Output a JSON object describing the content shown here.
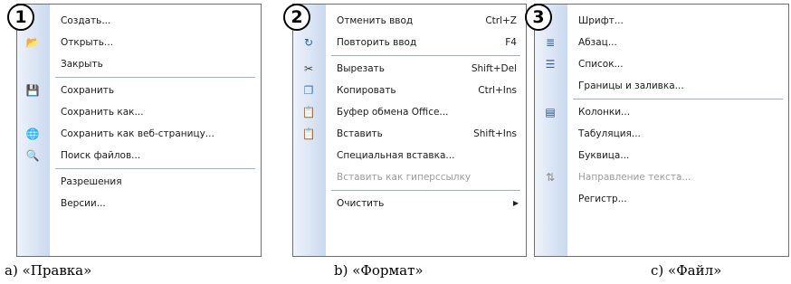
{
  "menus": [
    {
      "badge": "1",
      "caption": "а) «Правка»",
      "items": [
        {
          "type": "item",
          "label": "Создать...",
          "icon": ""
        },
        {
          "type": "item",
          "label": "Открыть...",
          "icon": "open-folder-icon"
        },
        {
          "type": "item",
          "label": "Закрыть",
          "icon": ""
        },
        {
          "type": "sep"
        },
        {
          "type": "item",
          "label": "Сохранить",
          "icon": "save-icon"
        },
        {
          "type": "item",
          "label": "Сохранить как...",
          "icon": ""
        },
        {
          "type": "item",
          "label": "Сохранить как веб-страницу...",
          "icon": "web-page-icon"
        },
        {
          "type": "item",
          "label": "Поиск файлов...",
          "icon": "file-search-icon"
        },
        {
          "type": "sep"
        },
        {
          "type": "item",
          "label": "Разрешения",
          "icon": ""
        },
        {
          "type": "item",
          "label": "Версии...",
          "icon": ""
        }
      ]
    },
    {
      "badge": "2",
      "caption": "b) «Формат»",
      "items": [
        {
          "type": "item",
          "label": "Отменить ввод",
          "shortcut": "Ctrl+Z",
          "icon": ""
        },
        {
          "type": "item",
          "label": "Повторить ввод",
          "shortcut": "F4",
          "icon": "redo-icon"
        },
        {
          "type": "sep"
        },
        {
          "type": "item",
          "label": "Вырезать",
          "shortcut": "Shift+Del",
          "icon": "scissors-icon"
        },
        {
          "type": "item",
          "label": "Копировать",
          "shortcut": "Ctrl+Ins",
          "icon": "copy-icon"
        },
        {
          "type": "item",
          "label": "Буфер обмена Office...",
          "icon": "clipboard-icon"
        },
        {
          "type": "item",
          "label": "Вставить",
          "shortcut": "Shift+Ins",
          "icon": "paste-icon"
        },
        {
          "type": "item",
          "label": "Специальная вставка...",
          "icon": ""
        },
        {
          "type": "item",
          "label": "Вставить как гиперссылку",
          "icon": "",
          "disabled": true
        },
        {
          "type": "sep"
        },
        {
          "type": "item",
          "label": "Очистить",
          "icon": "",
          "submenu": true
        }
      ]
    },
    {
      "badge": "3",
      "caption": "c) «Файл»",
      "items": [
        {
          "type": "item",
          "label": "Шрифт...",
          "icon": ""
        },
        {
          "type": "item",
          "label": "Абзац...",
          "icon": "paragraph-icon"
        },
        {
          "type": "item",
          "label": "Список...",
          "icon": "list-icon"
        },
        {
          "type": "item",
          "label": "Границы и заливка...",
          "icon": ""
        },
        {
          "type": "sep"
        },
        {
          "type": "item",
          "label": "Колонки...",
          "icon": "columns-icon"
        },
        {
          "type": "item",
          "label": "Табуляция...",
          "icon": ""
        },
        {
          "type": "item",
          "label": "Буквица...",
          "icon": ""
        },
        {
          "type": "item",
          "label": "Направление текста...",
          "icon": "text-direction-icon",
          "disabled": true
        },
        {
          "type": "item",
          "label": "Регистр...",
          "icon": ""
        }
      ]
    }
  ],
  "icon_glyphs": {
    "open-folder-icon": "📂",
    "save-icon": "💾",
    "web-page-icon": "🌐",
    "file-search-icon": "🔍",
    "redo-icon": "↻",
    "scissors-icon": "✂",
    "copy-icon": "❐",
    "clipboard-icon": "📋",
    "paste-icon": "📋",
    "paragraph-icon": "≣",
    "list-icon": "☰",
    "columns-icon": "▤",
    "text-direction-icon": "⇅"
  },
  "icon_colors": {
    "open-folder-icon": "#d9a32b",
    "save-icon": "#2b5aa8",
    "web-page-icon": "#2b79c2",
    "file-search-icon": "#3a6fb0",
    "redo-icon": "#1f5fbf",
    "scissors-icon": "#444444",
    "copy-icon": "#3a6fb0",
    "clipboard-icon": "#b8862b",
    "paste-icon": "#b8862b",
    "paragraph-icon": "#3a5f9a",
    "list-icon": "#3a5f9a",
    "columns-icon": "#2b4f86",
    "text-direction-icon": "#8a8a8a"
  },
  "submenu_arrow": "▶"
}
